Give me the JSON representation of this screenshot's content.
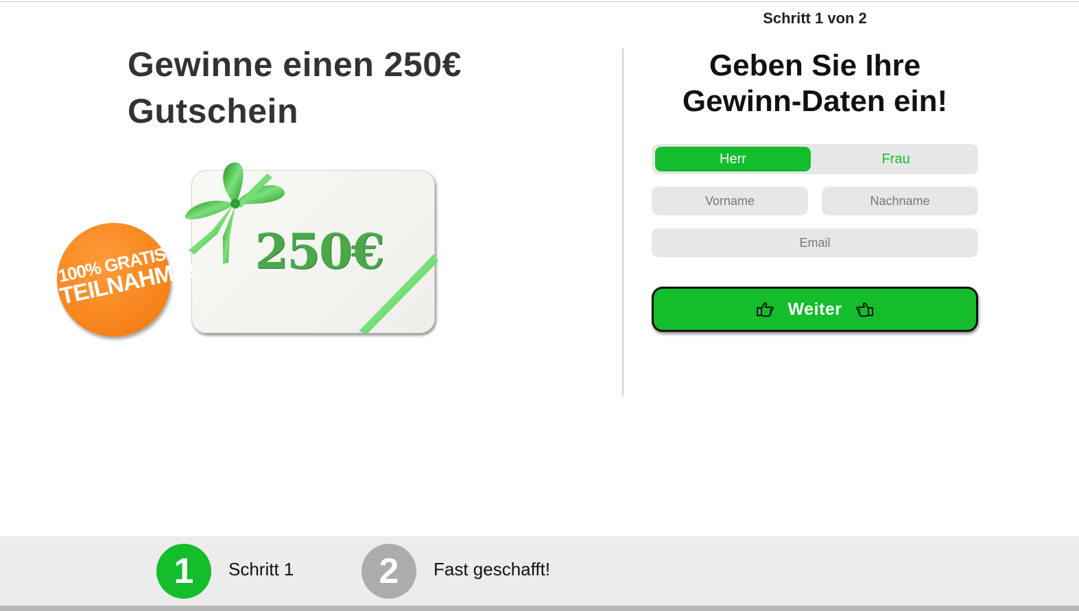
{
  "header": {
    "step_indicator": "Schritt 1 von 2"
  },
  "promo": {
    "headline": "Gewinne einen 250€ Gutschein",
    "card_amount": "250€",
    "badge_line1": "100% GRATIS",
    "badge_line2": "TEILNAHME!"
  },
  "form": {
    "title": "Geben Sie Ihre Gewinn-Daten ein!",
    "gender_options": [
      "Herr",
      "Frau"
    ],
    "gender_selected": "Herr",
    "first_name_placeholder": "Vorname",
    "last_name_placeholder": "Nachname",
    "email_placeholder": "Email",
    "submit_label": "Weiter"
  },
  "footer": {
    "steps": [
      {
        "number": "1",
        "label": "Schritt 1",
        "active": true
      },
      {
        "number": "2",
        "label": "Fast geschafft!",
        "active": false
      }
    ]
  },
  "colors": {
    "accent_green": "#13bd2b",
    "badge_orange": "#f7861e",
    "inactive_gray": "#acacac",
    "field_gray": "#e7e7e7"
  }
}
